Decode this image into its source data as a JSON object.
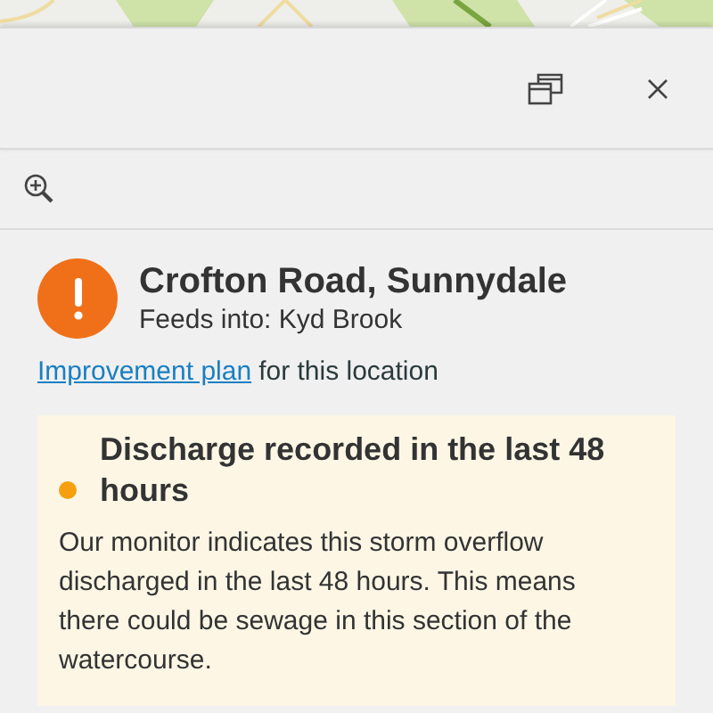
{
  "location": {
    "name": "Crofton Road, Sunnydale",
    "feeds_into": "Feeds into: Kyd Brook"
  },
  "link": {
    "label": "Improvement plan",
    "rest": "for this location"
  },
  "status": {
    "heading": "Discharge recorded in the last 48 hours",
    "body": "Our monitor indicates this storm overflow discharged in the last 48 hours. This means there could be sewage in this section of the watercourse."
  }
}
